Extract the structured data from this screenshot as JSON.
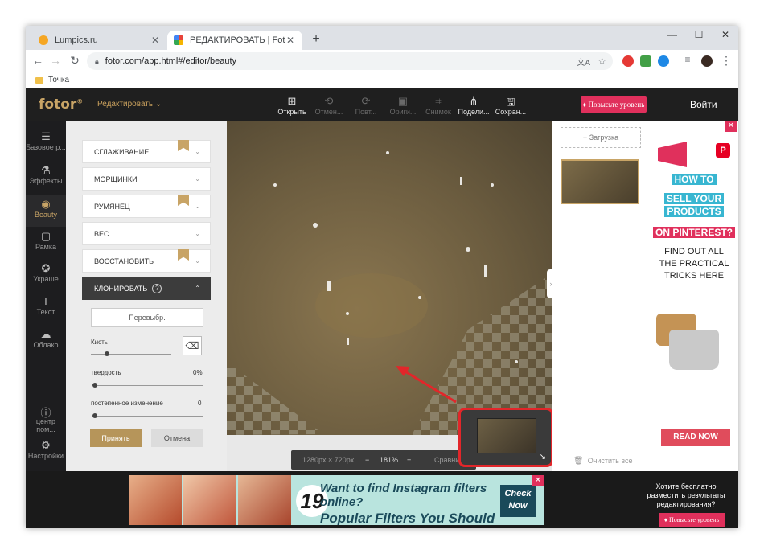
{
  "browser": {
    "tabs": [
      {
        "title": "Lumpics.ru",
        "favicon_color": "#f5a623"
      },
      {
        "title": "РЕДАКТИРОВАТЬ | Fotor",
        "favicon_color": "#e8433a"
      }
    ],
    "url": "fotor.com/app.html#/editor/beauty",
    "bookmark": "Точка"
  },
  "app": {
    "logo": "fotor",
    "logo_mark": "®",
    "edit_menu": "Редактировать",
    "toolbar": [
      {
        "label": "Открыть",
        "icon": "open-icon",
        "enabled": true
      },
      {
        "label": "Отмен...",
        "icon": "undo-icon",
        "enabled": false
      },
      {
        "label": "Повт...",
        "icon": "redo-icon",
        "enabled": false
      },
      {
        "label": "Ориги...",
        "icon": "original-icon",
        "enabled": false
      },
      {
        "label": "Снимок",
        "icon": "snapshot-icon",
        "enabled": false
      },
      {
        "label": "Подели...",
        "icon": "share-icon",
        "enabled": true
      },
      {
        "label": "Сохран...",
        "icon": "save-icon",
        "enabled": true
      }
    ],
    "upgrade": "Повысьте уровень",
    "login": "Войти"
  },
  "rail": [
    {
      "label": "Базовое р...",
      "icon": "sliders-icon"
    },
    {
      "label": "Эффекты",
      "icon": "flask-icon"
    },
    {
      "label": "Beauty",
      "icon": "eye-icon"
    },
    {
      "label": "Рамка",
      "icon": "frame-icon"
    },
    {
      "label": "Украше",
      "icon": "star-icon"
    },
    {
      "label": "Текст",
      "icon": "text-icon"
    },
    {
      "label": "Облако",
      "icon": "cloud-icon"
    },
    {
      "label": "центр пом...",
      "icon": "help-icon"
    },
    {
      "label": "Настройки",
      "icon": "settings-icon"
    }
  ],
  "panel": {
    "options": [
      {
        "label": "СГЛАЖИВАНИЕ",
        "premium": true
      },
      {
        "label": "МОРЩИНКИ",
        "premium": false
      },
      {
        "label": "РУМЯНЕЦ",
        "premium": true
      },
      {
        "label": "ВЕС",
        "premium": false
      },
      {
        "label": "ВОССТАНОВИТЬ",
        "premium": true
      }
    ],
    "clone_title": "КЛОНИРОВАТЬ",
    "reselect": "Перевыбр.",
    "brush_label": "Кисть",
    "hardness_label": "твердость",
    "hardness_value": "0%",
    "hardness_level": 0,
    "fade_label": "постепенное изменение",
    "fade_value": "0",
    "fade_level": 0,
    "brush_level": 0.2,
    "accept": "Принять",
    "cancel": "Отмена"
  },
  "canvas": {
    "size_text": "1280px × 720px",
    "zoom": "181%",
    "compare": "Сравнить"
  },
  "right_panel": {
    "upload": "Загрузка",
    "clear_all": "Очистить все"
  },
  "ad_right": {
    "line1": "HOW TO",
    "line2": "SELL YOUR",
    "line3": "PRODUCTS",
    "line4": "ON PINTEREST?",
    "body1": "FIND OUT ALL",
    "body2": "THE PRACTICAL",
    "body3": "TRICKS HERE",
    "cta": "READ NOW"
  },
  "ad_bottom": {
    "number": "19",
    "line1": "Want to find Instagram filters online?",
    "line2": "Popular Filters You Should Try",
    "cta1": "Check",
    "cta2": "Now"
  },
  "save_prompt": "Хотите бесплатно разместить результаты редактирования?",
  "upgrade_bottom": "Повысьте уровень"
}
